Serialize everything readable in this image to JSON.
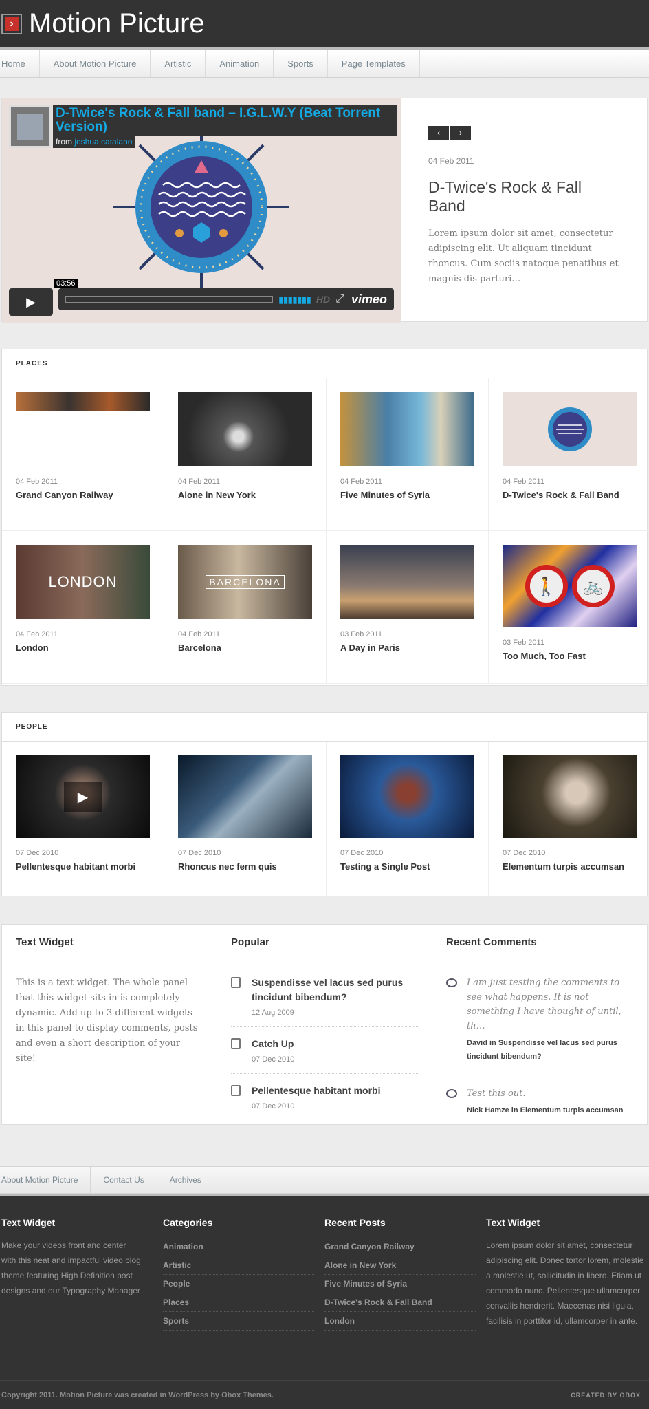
{
  "site": {
    "title": "Motion Picture",
    "logo_glyph": "›"
  },
  "nav": [
    "Home",
    "About Motion Picture",
    "Artistic",
    "Animation",
    "Sports",
    "Page Templates"
  ],
  "feature": {
    "video_title": "D-Twice's Rock & Fall band – I.G.L.W.Y (Beat Torrent Version)",
    "video_from_label": "from",
    "video_author": "joshua catalano",
    "video_time": "03:56",
    "video_hd": "HD",
    "video_brand": "vimeo",
    "date": "04 Feb 2011",
    "title": "D-Twice's Rock & Fall Band",
    "excerpt": "Lorem ipsum dolor sit amet, consectetur adipiscing elit. Ut aliquam tincidunt rhoncus. Cum sociis natoque penatibus et magnis dis parturi…"
  },
  "places": {
    "heading": "PLACES",
    "items": [
      {
        "date": "04 Feb 2011",
        "title": "Grand Canyon Railway"
      },
      {
        "date": "04 Feb 2011",
        "title": "Alone in New York"
      },
      {
        "date": "04 Feb 2011",
        "title": "Five Minutes of Syria"
      },
      {
        "date": "04 Feb 2011",
        "title": "D-Twice's Rock & Fall Band"
      },
      {
        "date": "04 Feb 2011",
        "title": "London",
        "overlay": "LONDON"
      },
      {
        "date": "04 Feb 2011",
        "title": "Barcelona",
        "overlay": "BARCELONA"
      },
      {
        "date": "03 Feb 2011",
        "title": "A Day in Paris"
      },
      {
        "date": "03 Feb 2011",
        "title": "Too Much, Too Fast"
      }
    ]
  },
  "people": {
    "heading": "PEOPLE",
    "items": [
      {
        "date": "07 Dec 2010",
        "title": "Pellentesque habitant morbi"
      },
      {
        "date": "07 Dec 2010",
        "title": "Rhoncus nec ferm quis"
      },
      {
        "date": "07 Dec 2010",
        "title": "Testing a Single Post"
      },
      {
        "date": "07 Dec 2010",
        "title": "Elementum turpis accumsan"
      }
    ]
  },
  "widgets": {
    "text": {
      "title": "Text Widget",
      "body": "This is a text widget. The whole panel that this widget sits in is completely dynamic. Add up to 3 different widgets in this panel to display comments, posts and even a short description of your site!"
    },
    "popular": {
      "title": "Popular",
      "items": [
        {
          "title": "Suspendisse vel lacus sed purus tincidunt bibendum?",
          "date": "12 Aug 2009"
        },
        {
          "title": "Catch Up",
          "date": "07 Dec 2010"
        },
        {
          "title": "Pellentesque habitant morbi",
          "date": "07 Dec 2010"
        }
      ]
    },
    "comments": {
      "title": "Recent Comments",
      "items": [
        {
          "text": "I am just testing the comments to see what happens. It is not something I have thought of until, th…",
          "meta": "David in Suspendisse vel lacus sed purus tincidunt bibendum?"
        },
        {
          "text": "Test this out.",
          "meta": "Nick Hamze in Elementum turpis accumsan"
        }
      ]
    }
  },
  "footer_nav": [
    "About Motion Picture",
    "Contact Us",
    "Archives"
  ],
  "footer": {
    "col1": {
      "title": "Text Widget",
      "body": "Make your videos front and center with this neat and impactful video blog theme featuring High Definition post designs and our Typography Manager"
    },
    "col2": {
      "title": "Categories",
      "links": [
        "Animation",
        "Artistic",
        "People",
        "Places",
        "Sports"
      ]
    },
    "col3": {
      "title": "Recent Posts",
      "links": [
        "Grand Canyon Railway",
        "Alone in New York",
        "Five Minutes of Syria",
        "D-Twice's Rock & Fall Band",
        "London"
      ]
    },
    "col4": {
      "title": "Text Widget",
      "body": "Lorem ipsum dolor sit amet, consectetur adipiscing elit. Donec tortor lorem, molestie a molestie ut, sollicitudin in libero. Etiam ut commodo nunc. Pellentesque ullamcorper convallis hendrerit. Maecenas nisi ligula, facilisis in porttitor id, ullamcorper in ante."
    },
    "copyright": "Copyright 2011. Motion Picture was created in WordPress by Obox Themes.",
    "credit": "CREATED BY OBOX"
  }
}
